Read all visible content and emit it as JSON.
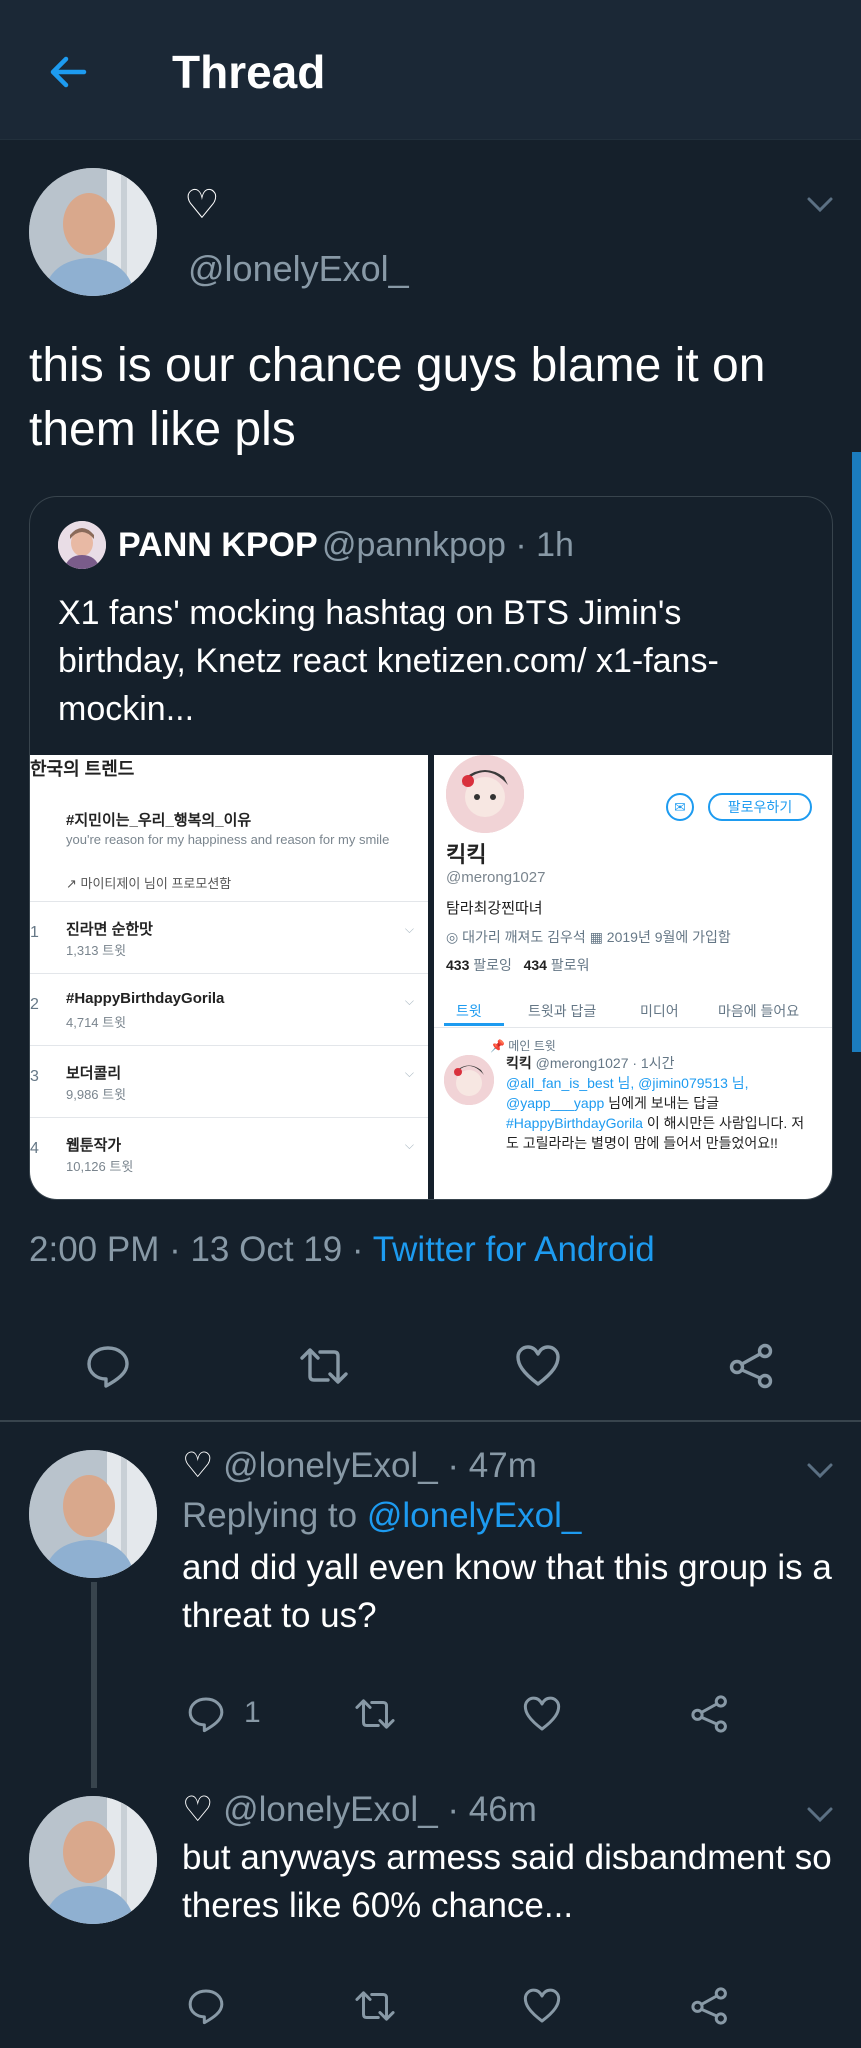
{
  "header": {
    "title": "Thread"
  },
  "main_tweet": {
    "heart": "♡",
    "handle": "@lonelyExol_",
    "text": "this is our chance guys blame it on them like pls",
    "timestamp": "2:00 PM · 13 Oct 19 · ",
    "source": "Twitter for Android"
  },
  "quote": {
    "name": "PANN KPOP",
    "handle_time": "@pannkpop · 1h",
    "text": "X1 fans' mocking hashtag on BTS Jimin's birthday, Knetz react knetizen.com/ x1-fans-mockin...",
    "trends": {
      "header": "한국의 트렌드",
      "promo_tag": "#지민이는_우리_행복의_이유",
      "promo_desc": "you're reason for my happiness and reason for my smile",
      "promo_by": "마이티제이 님이 프로모션함",
      "items": [
        {
          "rank": "1",
          "name": "진라면 순한맛",
          "count": "1,313 트윗"
        },
        {
          "rank": "2",
          "name": "#HappyBirthdayGorila",
          "count": "4,714 트윗"
        },
        {
          "rank": "3",
          "name": "보더콜리",
          "count": "9,986 트윗"
        },
        {
          "rank": "4",
          "name": "웹툰작가",
          "count": "10,126 트윗"
        }
      ]
    },
    "profile": {
      "follow_label": "팔로우하기",
      "name": "킥킥",
      "handle": "@merong1027",
      "bio": "탐라최강찐따녀",
      "meta": "◎ 대가리 깨져도 김우석  ▦ 2019년 9월에 가입함",
      "following_count": "433",
      "following_label": "팔로잉",
      "followers_count": "434",
      "followers_label": "팔로워",
      "tabs": [
        "트윗",
        "트윗과 답글",
        "미디어",
        "마음에 들어요"
      ],
      "pinned_label": "📌 메인 트윗",
      "pinned_name": "킥킥",
      "pinned_meta": "@merong1027 · 1시간",
      "pinned_mentions": "@all_fan_is_best 님, @jimin079513 님, @yapp___yapp",
      "pinned_mid": " 님에게 보내는 답글 ",
      "pinned_tag": "#HappyBirthdayGorila",
      "pinned_rest": " 이 해시만든 사람입니다. 저도 고릴라라는 별명이 맘에 들어서 만들었어요!!"
    }
  },
  "replies": [
    {
      "heart": "♡",
      "handle_time": "@lonelyExol_ · 47m",
      "replying_label": "Replying to ",
      "replying_handle": "@lonelyExol_",
      "text": "and did yall even know that this group is a threat to us?",
      "reply_count": "1"
    },
    {
      "heart": "♡",
      "handle_time": "@lonelyExol_ · 46m",
      "text": "but anyways armess said disbandment so theres like 60% chance..."
    }
  ],
  "colors": {
    "background": "#15202b",
    "accent": "#1d9bf0",
    "muted": "#8899a6"
  }
}
